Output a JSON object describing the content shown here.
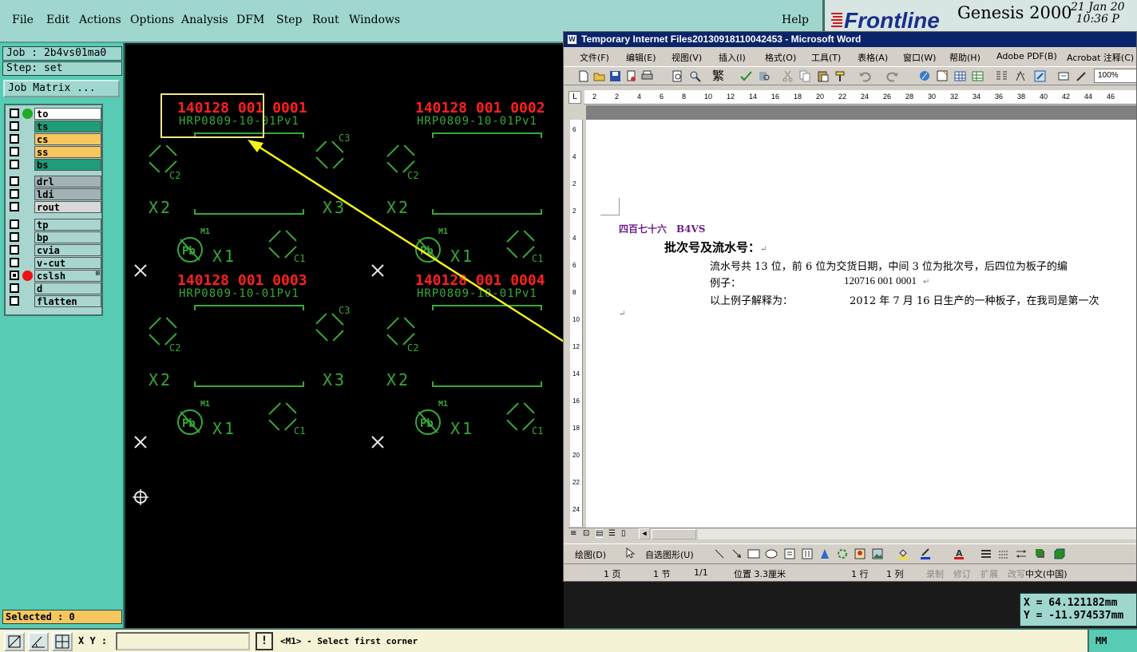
{
  "menubar": {
    "items": [
      "File",
      "Edit",
      "Actions",
      "Options",
      "Analysis",
      "DFM",
      "Step",
      "Rout",
      "Windows"
    ],
    "help": "Help"
  },
  "brand": {
    "logo_text": "Frontline",
    "product": "Genesis 2000",
    "date": "21 Jan 20",
    "time": "10:36 P"
  },
  "left_panel": {
    "job": "Job : 2b4vs01ma0",
    "step": "Step: set",
    "job_matrix_button": "Job Matrix ...",
    "layers": [
      {
        "name": "to",
        "bg": "#ffffff",
        "dot": "#22aa22",
        "checked": false
      },
      {
        "name": "ts",
        "bg": "#1f9c7a",
        "dot": "",
        "checked": false
      },
      {
        "name": "cs",
        "bg": "#f6c75d",
        "dot": "",
        "checked": false
      },
      {
        "name": "ss",
        "bg": "#f6c75d",
        "dot": "",
        "checked": false
      },
      {
        "name": "bs",
        "bg": "#1f9c7a",
        "dot": "",
        "checked": false
      },
      {
        "name": "drl",
        "bg": "#a2b3b6",
        "dot": "",
        "checked": false
      },
      {
        "name": "ldi",
        "bg": "#a2b3b6",
        "dot": "",
        "checked": false
      },
      {
        "name": "rout",
        "bg": "#d8d8d8",
        "dot": "",
        "checked": false
      },
      {
        "name": "tp",
        "bg": "#a8d5d0",
        "dot": "",
        "checked": false
      },
      {
        "name": "bp",
        "bg": "#a8d5d0",
        "dot": "",
        "checked": false
      },
      {
        "name": "cvia",
        "bg": "#a8d5d0",
        "dot": "",
        "checked": false
      },
      {
        "name": "v-cut",
        "bg": "#a8d5d0",
        "dot": "",
        "checked": false
      },
      {
        "name": "cslsh",
        "bg": "#a8d5d0",
        "dot": "#ee1111",
        "checked": true,
        "flag": "⊞"
      },
      {
        "name": "d",
        "bg": "#a8d5d0",
        "dot": "",
        "checked": false
      },
      {
        "name": "flatten",
        "bg": "#a8d5d0",
        "dot": "",
        "checked": false
      }
    ],
    "selected": "Selected : 0"
  },
  "canvas": {
    "serials": [
      "140128 001 0001",
      "140128 001 0002",
      "140128 001 0003",
      "140128 001 0004"
    ],
    "part_number": "HRP0809-10-01Pv1",
    "labels": {
      "c1": "C1",
      "c2": "C2",
      "c3": "C3",
      "x1": "X1",
      "x2": "X2",
      "x3": "X3",
      "m1": "M1",
      "pb": "Pb"
    }
  },
  "word": {
    "title": "Temporary Internet Files20130918110042453 - Microsoft Word",
    "menus": [
      "文件(F)",
      "编辑(E)",
      "视图(V)",
      "插入(I)",
      "格式(O)",
      "工具(T)",
      "表格(A)",
      "窗口(W)",
      "帮助(H)",
      "Adobe PDF(B)",
      "Acrobat 注释(C)"
    ],
    "zoom": "100%",
    "ruler_numbers": [
      "2",
      "2",
      "4",
      "6",
      "8",
      "10",
      "12",
      "14",
      "16",
      "18",
      "20",
      "22",
      "24",
      "26",
      "28",
      "30",
      "32",
      "34",
      "36",
      "38",
      "40",
      "42",
      "44",
      "46"
    ],
    "vruler_numbers": [
      "6",
      "4",
      "2",
      "2",
      "4",
      "6",
      "8",
      "10",
      "12",
      "14",
      "16",
      "18",
      "20",
      "22",
      "24"
    ],
    "doc": {
      "heading": "四百七十六　B4VS",
      "subheading": "批次号及流水号：",
      "line1": "流水号共 13 位，前 6 位为交货日期，中间 3 位为批次号，后四位为板子的编",
      "line2a": "例子：",
      "line2b": "120716 001 0001",
      "line3a": "以上例子解释为：",
      "line3b": "2012 年 7 月 16 日生产的一种板子，在我司是第一次",
      "para_mark": "↵"
    },
    "drawbar": {
      "draw": "绘图(D)",
      "autoshapes": "自选图形(U)"
    },
    "status": {
      "page": "1 页",
      "section": "1 节",
      "pages": "1/1",
      "position": "位置 3.3厘米",
      "line": "1 行",
      "col": "1 列",
      "rec": "录制",
      "trk": "修订",
      "ext": "扩展",
      "ovr": "改写",
      "lang": "中文(中国)"
    }
  },
  "coords": {
    "x": "X = 64.121182mm",
    "y": "Y = -11.974537mm"
  },
  "bottom": {
    "xy_label": "X Y :",
    "xy_value": "",
    "alert": "!",
    "prompt": "<M1> - Select first corner",
    "units": "MM"
  },
  "colors": {
    "serial_red": "#ff2020",
    "pcb_green": "#38a838",
    "arrow": "#f2f21a",
    "selection_box": "#f0e68c"
  }
}
